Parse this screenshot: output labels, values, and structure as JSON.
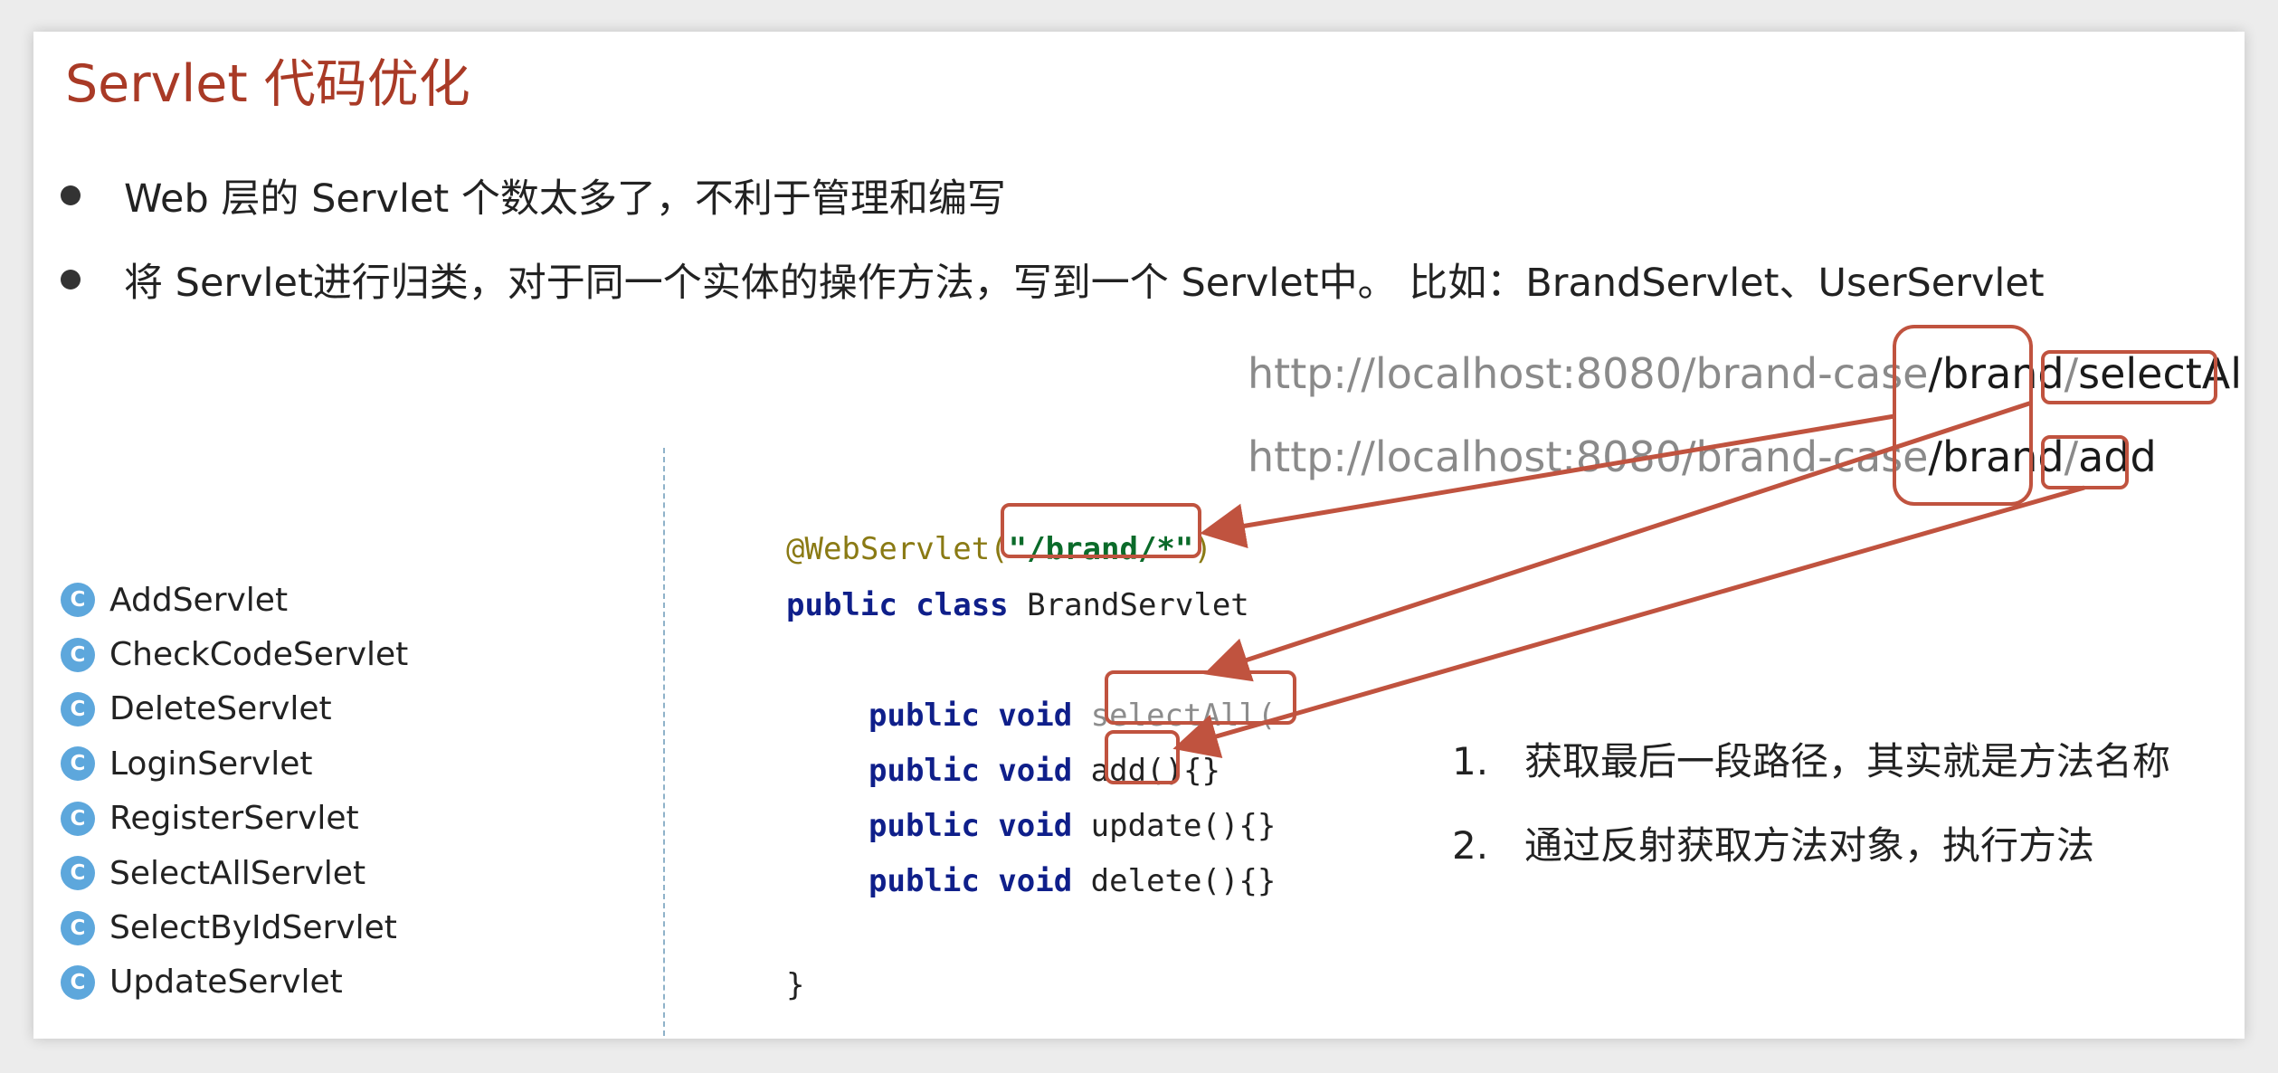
{
  "title": "Servlet 代码优化",
  "bullets": [
    "Web 层的 Servlet 个数太多了，不利于管理和编写",
    "将 Servlet进行归类，对于同一个实体的操作方法，写到一个 Servlet中。 比如：BrandServlet、UserServlet"
  ],
  "urls": [
    {
      "base": "http://localhost:8080/brand-case",
      "brand": "/brand",
      "slash": "/",
      "method": "selectAll"
    },
    {
      "base": "http://localhost:8080/brand-case",
      "brand": "/brand",
      "slash": "/",
      "method": "add"
    }
  ],
  "icon_letter": "C",
  "class_list": [
    "AddServlet",
    "CheckCodeServlet",
    "DeleteServlet",
    "LoginServlet",
    "RegisterServlet",
    "SelectAllServlet",
    "SelectByIdServlet",
    "UpdateServlet"
  ],
  "code": {
    "annotation": "@WebServlet",
    "open_paren": "(",
    "path": "\"/brand/*\"",
    "close_paren": ")",
    "class_keywords": "public class",
    "class_name": "BrandServlet",
    "method_keywords": "public void",
    "methods": [
      {
        "name": "selectAll",
        "rest": "("
      },
      {
        "name": "add",
        "rest": "(){}"
      },
      {
        "name": "update",
        "rest": "(){}"
      },
      {
        "name": "delete",
        "rest": "(){}"
      }
    ],
    "closing_brace": "}"
  },
  "steps": [
    {
      "num": "1.",
      "text": "获取最后一段路径，其实就是方法名称"
    },
    {
      "num": "2.",
      "text": "通过反射获取方法对象，执行方法"
    }
  ],
  "colors": {
    "title": "#a93a26",
    "highlight": "#c0533f",
    "keyword": "#0f1f8a",
    "annotation": "#8a7a14",
    "string": "#0b6b2a",
    "class_icon": "#5da7dc"
  }
}
